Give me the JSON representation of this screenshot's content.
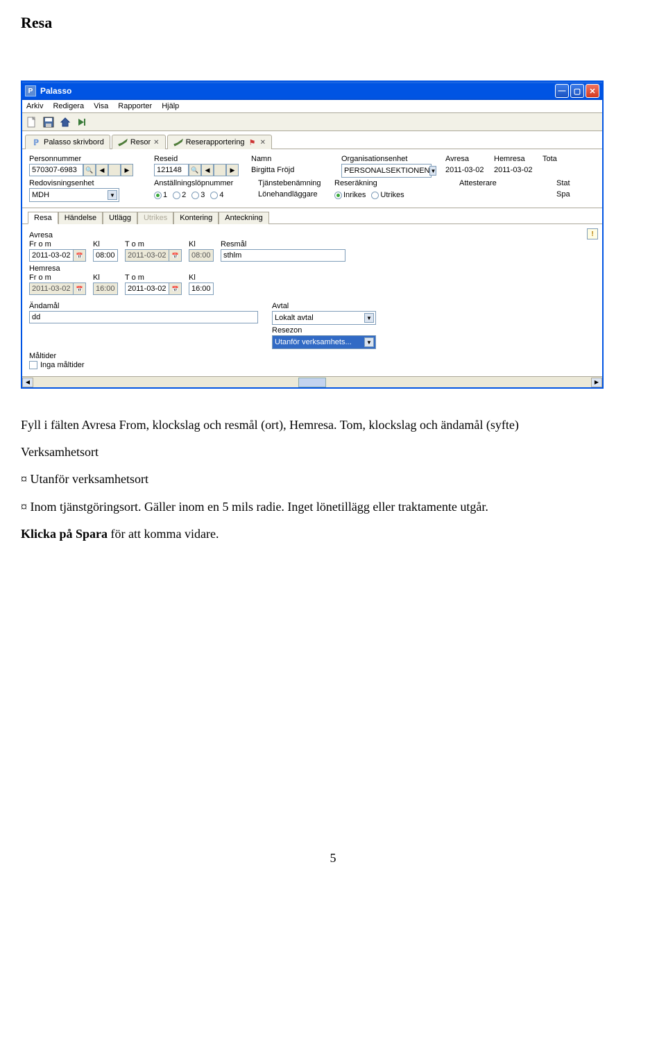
{
  "doc_heading": "Resa",
  "titlebar": {
    "app_icon_letter": "P",
    "title": "Palasso"
  },
  "menubar": [
    "Arkiv",
    "Redigera",
    "Visa",
    "Rapporter",
    "Hjälp"
  ],
  "tabs": [
    {
      "icon": "P",
      "label": "Palasso skrivbord",
      "closable": false
    },
    {
      "icon": "travel",
      "label": "Resor",
      "closable": true
    },
    {
      "icon": "travel",
      "label": "Reserapportering",
      "closable": true,
      "flag": true
    }
  ],
  "header_form": {
    "personnummer": {
      "label": "Personnummer",
      "value": "570307-6983"
    },
    "reseid": {
      "label": "Reseid",
      "value": "121148"
    },
    "namn": {
      "label": "Namn",
      "value": "Birgitta Fröjd"
    },
    "orgenhet": {
      "label": "Organisationsenhet",
      "value": "PERSONALSEKTIONEN"
    },
    "avresa": {
      "label": "Avresa",
      "value": "2011-03-02"
    },
    "hemresa": {
      "label": "Hemresa",
      "value": "2011-03-02"
    },
    "tota": {
      "label": "Tota"
    },
    "redov": {
      "label": "Redovisningsenhet",
      "value": "MDH"
    },
    "anst": {
      "label": "Anställningslöpnummer",
      "options": [
        "1",
        "2",
        "3",
        "4"
      ],
      "selected": "1"
    },
    "tjbenam": {
      "label": "Tjänstebenämning",
      "value": "Lönehandläggare"
    },
    "reserakning": {
      "label": "Reseräkning",
      "options": [
        "Inrikes",
        "Utrikes"
      ],
      "selected": "Inrikes"
    },
    "attest": {
      "label": "Attesterare",
      "value": ""
    },
    "stat": {
      "label": "Stat",
      "value": "Spa"
    }
  },
  "subtabs": [
    "Resa",
    "Händelse",
    "Utlägg",
    "Utrikes",
    "Kontering",
    "Anteckning"
  ],
  "subtab_active": "Resa",
  "subtab_disabled": "Utrikes",
  "panel": {
    "avresa_section": "Avresa",
    "hemresa_section": "Hemresa",
    "from_label": "Fr o m",
    "kl_label": "Kl",
    "tom_label": "T o m",
    "resmal_label": "Resmål",
    "avresa": {
      "from": "2011-03-02",
      "kl1": "08:00",
      "tom": "2011-03-02",
      "kl2": "08:00",
      "resmal": "sthlm"
    },
    "hemresa": {
      "from": "2011-03-02",
      "kl1": "16:00",
      "tom": "2011-03-02",
      "kl2": "16:00"
    },
    "andamal_label": "Ändamål",
    "andamal_value": "dd",
    "avtal_label": "Avtal",
    "avtal_value": "Lokalt avtal",
    "resezon_label": "Resezon",
    "resezon_value": "Utanför verksamhets...",
    "maltider_label": "Måltider",
    "inga_maltider": "Inga måltider"
  },
  "body_paragraphs": [
    "Fyll i fälten Avresa From, klockslag och resmål (ort), Hemresa. Tom, klockslag och ändamål (syfte)",
    "Verksamhetsort",
    "¤ Utanför verksamhetsort",
    "¤ Inom tjänstgöringsort. Gäller inom en 5 mils radie. Inget lönetillägg eller traktamente utgår."
  ],
  "final_line_prefix": "Klicka på Spara",
  "final_line_rest": " för att komma vidare.",
  "page_number": "5"
}
